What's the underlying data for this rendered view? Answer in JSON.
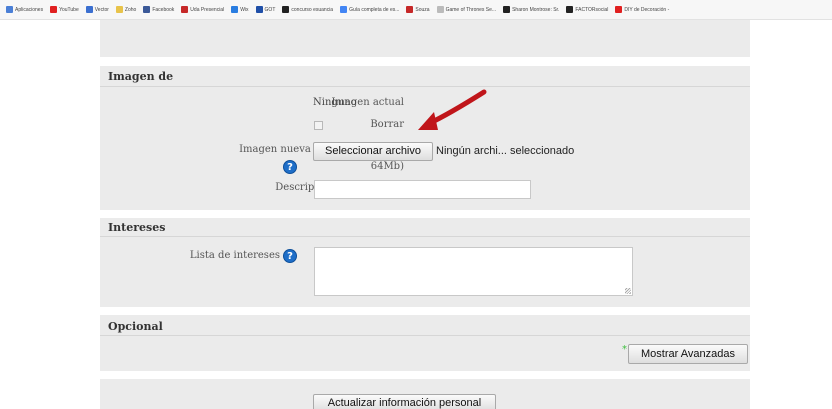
{
  "bookmarks": [
    {
      "label": "Aplicaciones",
      "icon": "apps-icon",
      "color": "#4a7fd6"
    },
    {
      "label": "YouTube",
      "icon": "youtube-icon",
      "color": "#e02020"
    },
    {
      "label": "Vector",
      "icon": "vector-icon",
      "color": "#3b6fd0"
    },
    {
      "label": "Zoho",
      "icon": "zoho-folder-icon",
      "color": "#e8c34a"
    },
    {
      "label": "Facebook",
      "icon": "facebook-icon",
      "color": "#3b5998"
    },
    {
      "label": "Uda Presencial",
      "icon": "uda-icon",
      "color": "#c62828"
    },
    {
      "label": "Wix",
      "icon": "wix-icon",
      "color": "#2a7de1"
    },
    {
      "label": "GOT",
      "icon": "got-icon",
      "color": "#1f4fa8"
    },
    {
      "label": "concurso esuancia",
      "icon": "dot-icon",
      "color": "#222222"
    },
    {
      "label": "Guía completa de es...",
      "icon": "google-icon",
      "color": "#4285f4"
    },
    {
      "label": "Souza",
      "icon": "souza-icon",
      "color": "#c62828"
    },
    {
      "label": "Game of Thrones Se...",
      "icon": "page-icon",
      "color": "#bbbbbb"
    },
    {
      "label": "Sharon Montrose: Sr.",
      "icon": "dot-icon",
      "color": "#222222"
    },
    {
      "label": "FACTORsocial",
      "icon": "factor-icon",
      "color": "#222222"
    },
    {
      "label": "DIY de Decoración -",
      "icon": "youtube-icon",
      "color": "#e02020"
    }
  ],
  "sections": {
    "imagen": {
      "legend": "Imagen de",
      "current_image_label": "Imagen actual",
      "current_image_value": "Ninguno",
      "delete_label": "Borrar",
      "new_image_label_line1": "Imagen nueva (Tamaño máximo:",
      "new_image_label_line2": "64Mb)",
      "file_button": "Seleccionar archivo",
      "file_status": "Ningún archi... seleccionado",
      "description_label": "Descripción de la imagen",
      "description_value": ""
    },
    "intereses": {
      "legend": "Intereses",
      "interests_label": "Lista de intereses",
      "interests_value": ""
    },
    "opcional": {
      "legend": "Opcional",
      "show_advanced_button": "Mostrar Avanzadas",
      "marker": "*"
    }
  },
  "submit_button": "Actualizar información personal",
  "colors": {
    "section_bg": "#ebebeb",
    "help_icon": "#1e6ec8",
    "arrow": "#c0151a",
    "required_marker": "#3fbf3f"
  }
}
